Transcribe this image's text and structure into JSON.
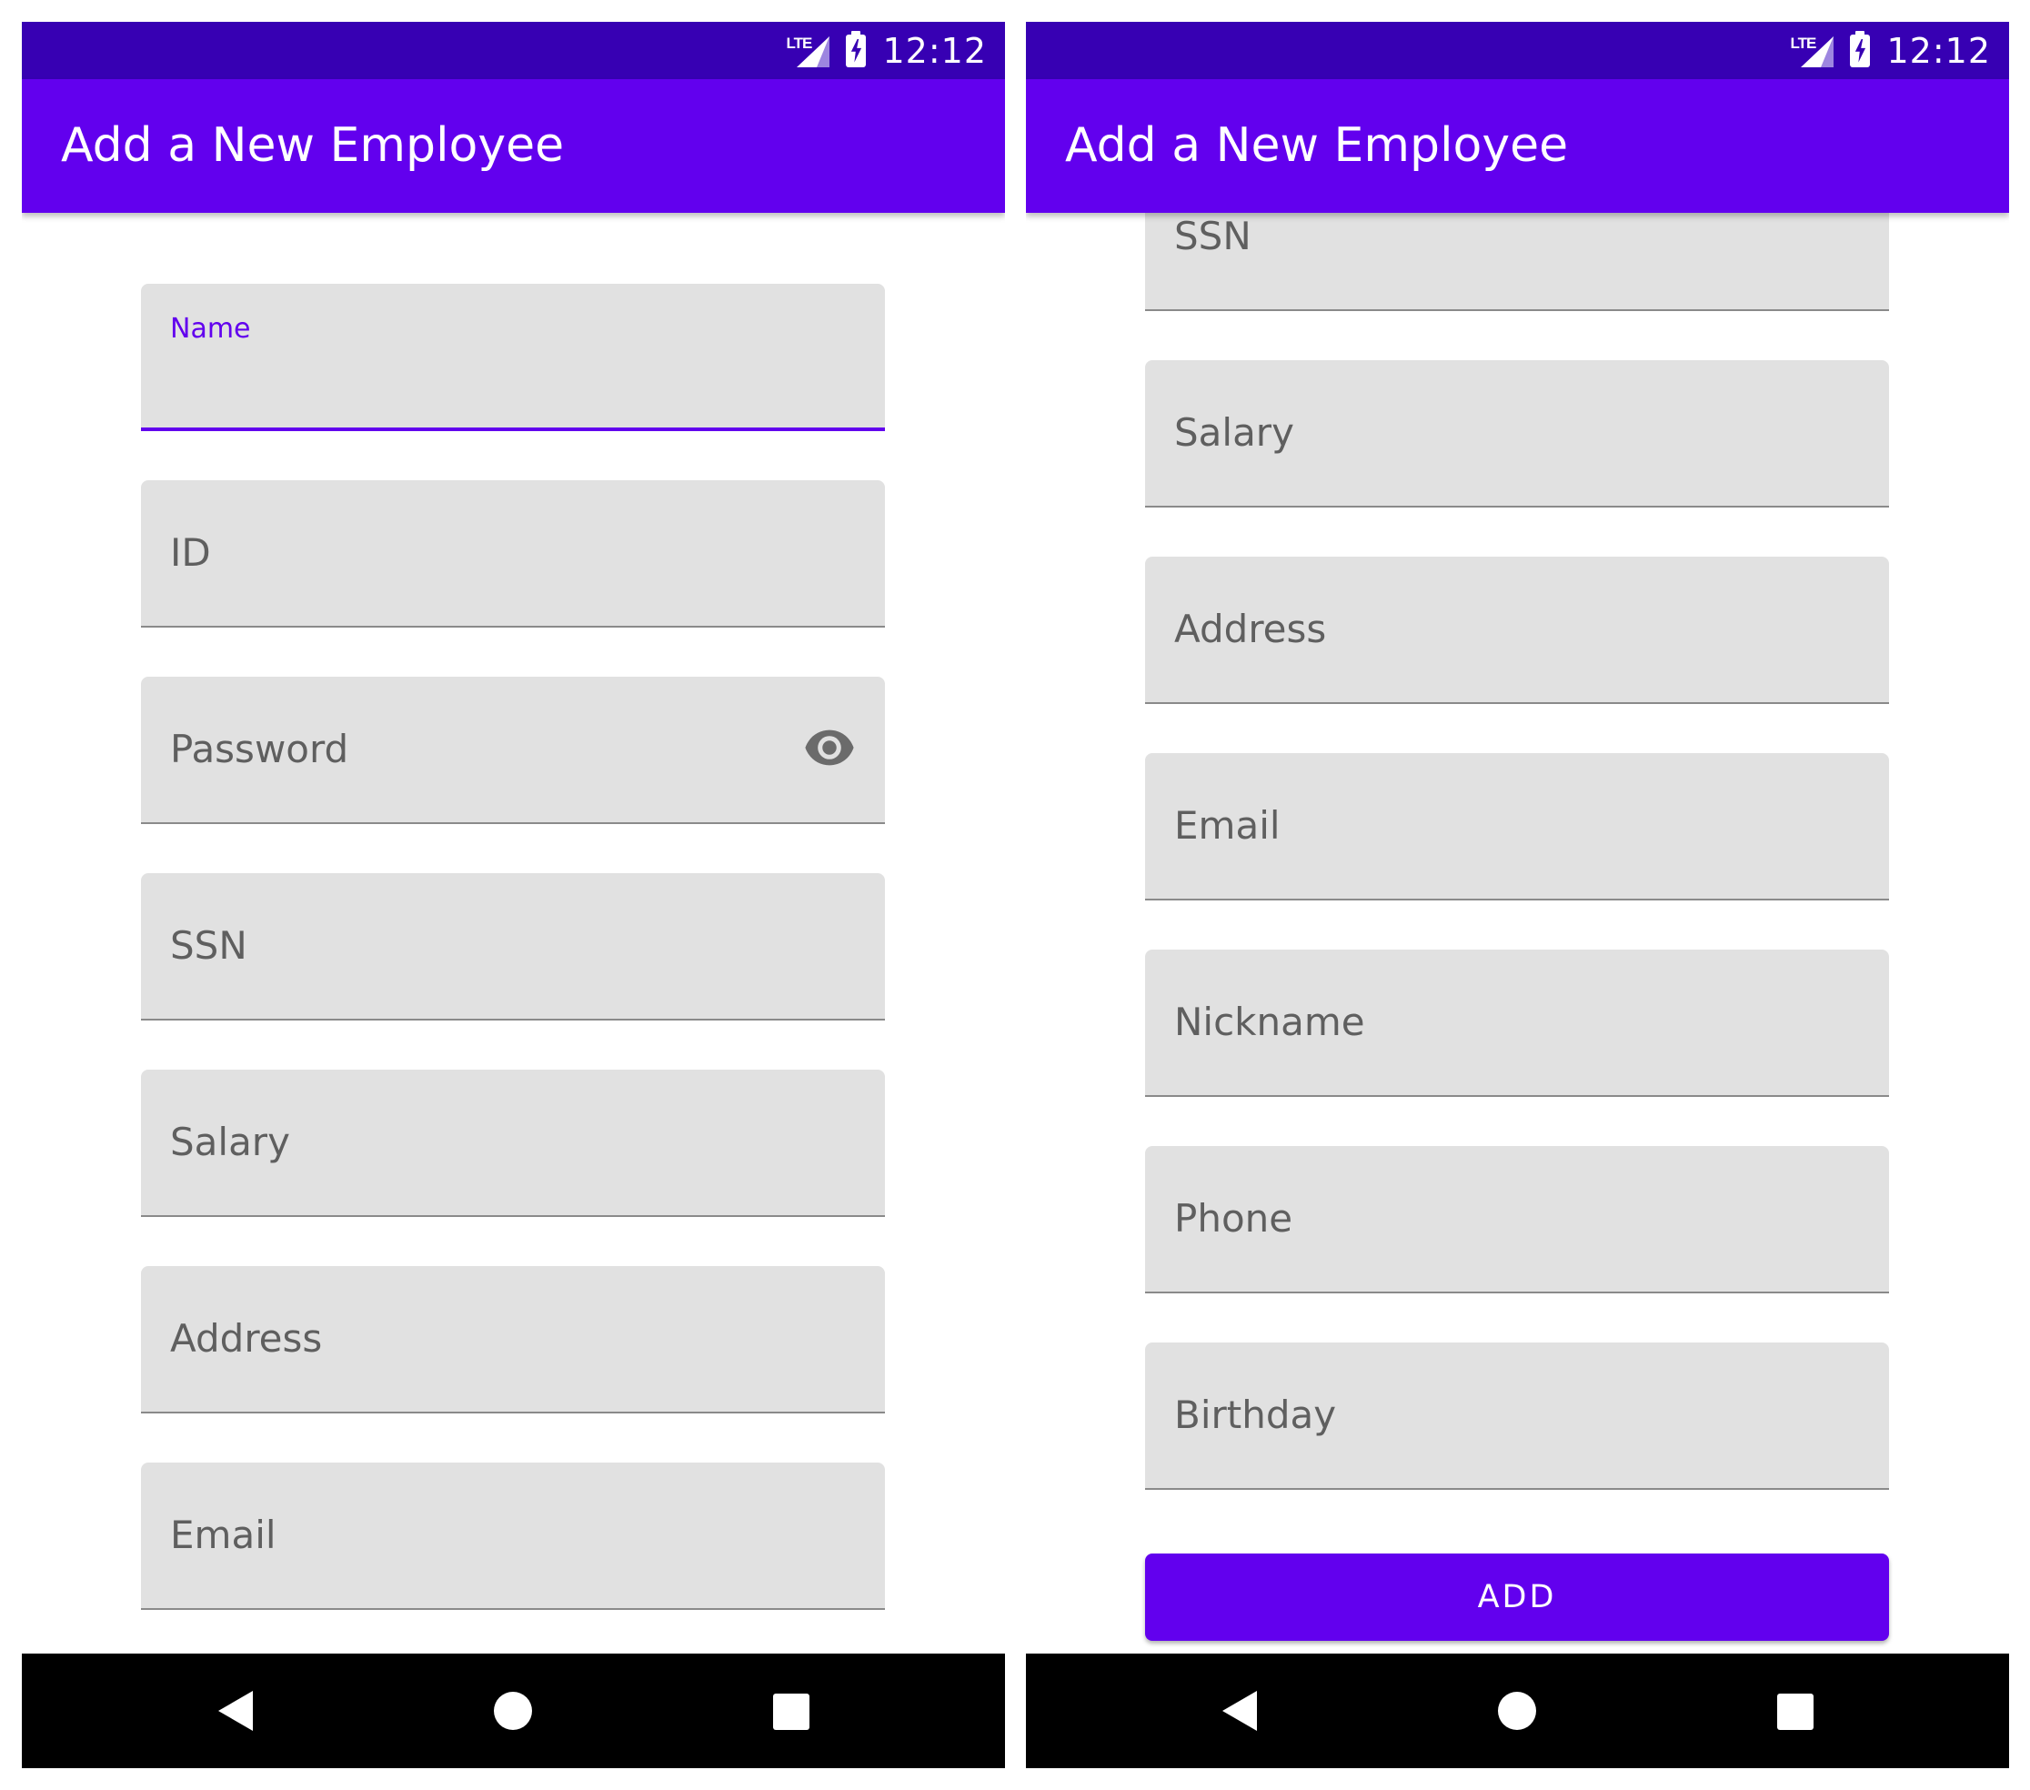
{
  "status_bar": {
    "network": "LTE",
    "time": "12:12"
  },
  "app_bar": {
    "title": "Add a New Employee"
  },
  "left_screen": {
    "fields": [
      {
        "label": "Name",
        "focused": true
      },
      {
        "label": "ID"
      },
      {
        "label": "Password",
        "trailing_icon": "eye-icon"
      },
      {
        "label": "SSN"
      },
      {
        "label": "Salary"
      },
      {
        "label": "Address"
      },
      {
        "label": "Email"
      }
    ]
  },
  "right_screen": {
    "fields": [
      {
        "label": "SSN"
      },
      {
        "label": "Salary"
      },
      {
        "label": "Address"
      },
      {
        "label": "Email"
      },
      {
        "label": "Nickname"
      },
      {
        "label": "Phone"
      },
      {
        "label": "Birthday"
      }
    ],
    "add_button": {
      "label": "ADD"
    }
  },
  "nav_bar": {
    "icons": [
      "back-icon",
      "home-icon",
      "recents-icon"
    ]
  },
  "colors": {
    "primary": "#6200ee",
    "primary_dark": "#3700b3",
    "field_bg": "#e1e1e1",
    "label": "#5f5f5f"
  }
}
